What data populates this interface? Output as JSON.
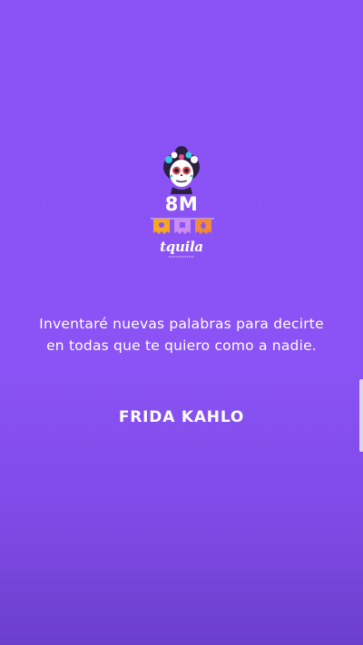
{
  "brand": {
    "event": "8M",
    "logo_text": "tquila"
  },
  "quote": {
    "line1": "Inventaré nuevas palabras para decirte",
    "line2": "en todas que te quiero como a nadie."
  },
  "author": "FRIDA KAHLO",
  "icons": [
    "skull-icon",
    "papel-picado-banner-icon"
  ],
  "colors": {
    "background": "#8b53f5",
    "text": "#ffffff",
    "banner_colors": [
      "#f5a623",
      "#c98cf0",
      "#f08a3c"
    ]
  }
}
